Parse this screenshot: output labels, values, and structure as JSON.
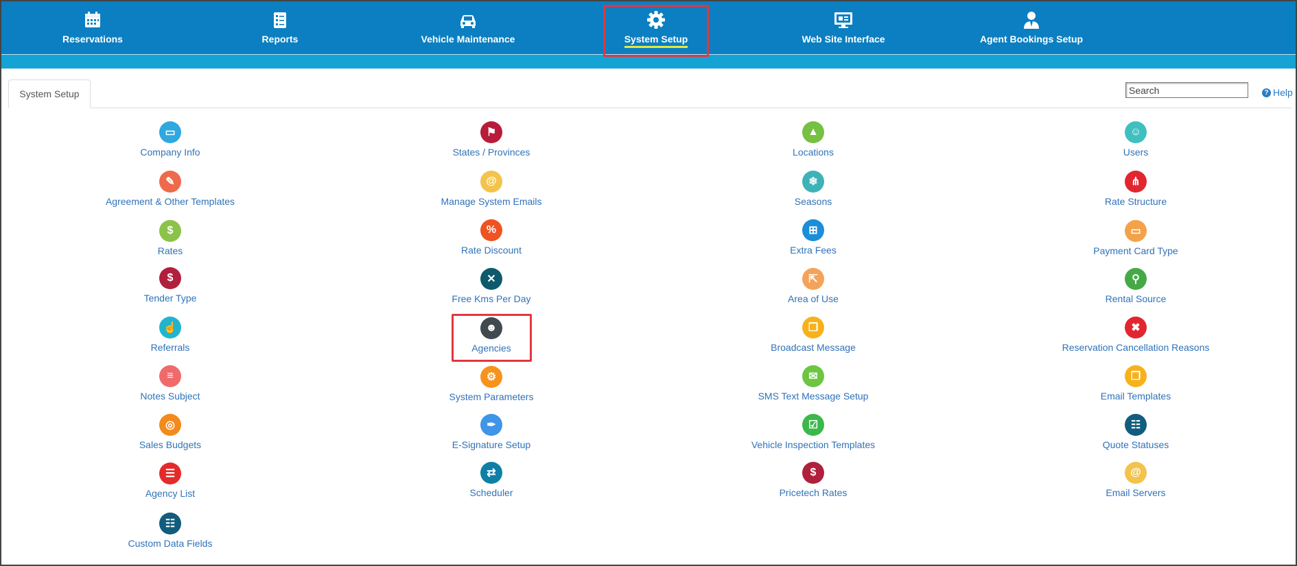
{
  "nav": {
    "items": [
      {
        "label": "Reservations",
        "icon": "calendar-icon"
      },
      {
        "label": "Reports",
        "icon": "report-checklist-icon"
      },
      {
        "label": "Vehicle Maintenance",
        "icon": "car-icon"
      },
      {
        "label": "System Setup",
        "icon": "gear-icon",
        "active": true
      },
      {
        "label": "Web Site Interface",
        "icon": "monitor-icon"
      },
      {
        "label": "Agent Bookings Setup",
        "icon": "agent-user-icon"
      }
    ]
  },
  "tab": {
    "label": "System Setup"
  },
  "search": {
    "placeholder": "Search"
  },
  "help": {
    "label": "Help"
  },
  "colors": {
    "nav_bg": "#0b7fc1",
    "subbar": "#14a3d4",
    "link": "#2f72b9",
    "highlight": "#e0373f"
  },
  "columns": [
    {
      "items": [
        {
          "label": "Company Info",
          "icon": "folder-icon",
          "color": "#2fa8e0",
          "glyph": "▭"
        },
        {
          "label": "Agreement & Other Templates",
          "icon": "edit-document-icon",
          "color": "#ee6a4b",
          "glyph": "✎"
        },
        {
          "label": "Rates",
          "icon": "rates-coins-icon",
          "color": "#8bc34a",
          "glyph": "$"
        },
        {
          "label": "Tender Type",
          "icon": "money-bag-icon",
          "color": "#b01f3c",
          "glyph": "$"
        },
        {
          "label": "Referrals",
          "icon": "hand-referral-icon",
          "color": "#20b4cf",
          "glyph": "☝"
        },
        {
          "label": "Notes Subject",
          "icon": "notes-stack-icon",
          "color": "#ef6b6b",
          "glyph": "≡"
        },
        {
          "label": "Sales Budgets",
          "icon": "target-icon",
          "color": "#f28a1c",
          "glyph": "◎"
        },
        {
          "label": "Agency List",
          "icon": "list-document-icon",
          "color": "#e42a2a",
          "glyph": "☰"
        },
        {
          "label": "Custom Data Fields",
          "icon": "list-bullets-icon",
          "color": "#125c7e",
          "glyph": "☷"
        }
      ]
    },
    {
      "items": [
        {
          "label": "States / Provinces",
          "icon": "flag-icon",
          "color": "#b71c3a",
          "glyph": "⚑"
        },
        {
          "label": "Manage System Emails",
          "icon": "at-sign-icon",
          "color": "#f3c34c",
          "glyph": "@"
        },
        {
          "label": "Rate Discount",
          "icon": "percent-icon",
          "color": "#ef5322",
          "glyph": "%"
        },
        {
          "label": "Free Kms Per Day",
          "icon": "road-crossing-icon",
          "color": "#0d5a6c",
          "glyph": "✕"
        },
        {
          "label": "Agencies",
          "icon": "people-group-icon",
          "color": "#404a4f",
          "glyph": "☻"
        },
        {
          "label": "System Parameters",
          "icon": "gears-icon",
          "color": "#f6931d",
          "glyph": "⚙"
        },
        {
          "label": "E-Signature Setup",
          "icon": "pen-signature-icon",
          "color": "#3f95e8",
          "glyph": "✒"
        },
        {
          "label": "Scheduler",
          "icon": "car-scheduler-icon",
          "color": "#0f7fa6",
          "glyph": "⇄"
        }
      ]
    },
    {
      "items": [
        {
          "label": "Locations",
          "icon": "map-location-icon",
          "color": "#76c043",
          "glyph": "▲"
        },
        {
          "label": "Seasons",
          "icon": "snowflake-icon",
          "color": "#3fb2b9",
          "glyph": "❄"
        },
        {
          "label": "Extra Fees",
          "icon": "grid-fees-icon",
          "color": "#1c8dd8",
          "glyph": "⊞"
        },
        {
          "label": "Area of Use",
          "icon": "signpost-icon",
          "color": "#f4a35a",
          "glyph": "⇱"
        },
        {
          "label": "Broadcast Message",
          "icon": "copy-windows-icon",
          "color": "#f7b21b",
          "glyph": "❐"
        },
        {
          "label": "SMS Text Message Setup",
          "icon": "sms-bubble-icon",
          "color": "#6cc640",
          "glyph": "✉"
        },
        {
          "label": "Vehicle Inspection Templates",
          "icon": "clipboard-check-icon",
          "color": "#3bb84a",
          "glyph": "☑"
        },
        {
          "label": "Pricetech Rates",
          "icon": "money-bag-icon",
          "color": "#b01f3c",
          "glyph": "$"
        }
      ]
    },
    {
      "items": [
        {
          "label": "Users",
          "icon": "users-group-icon",
          "color": "#40bfc1",
          "glyph": "☺"
        },
        {
          "label": "Rate Structure",
          "icon": "share-nodes-icon",
          "color": "#e1262f",
          "glyph": "⋔"
        },
        {
          "label": "Payment Card Type",
          "icon": "credit-card-icon",
          "color": "#f4a24a",
          "glyph": "▭"
        },
        {
          "label": "Rental Source",
          "icon": "magnifier-icon",
          "color": "#46a947",
          "glyph": "⚲"
        },
        {
          "label": "Reservation Cancellation Reasons",
          "icon": "cancel-x-icon",
          "color": "#e2262f",
          "glyph": "✖"
        },
        {
          "label": "Email Templates",
          "icon": "copy-windows-icon",
          "color": "#f7b21b",
          "glyph": "❐"
        },
        {
          "label": "Quote Statuses",
          "icon": "list-bullets-icon",
          "color": "#125c7e",
          "glyph": "☷"
        },
        {
          "label": "Email Servers",
          "icon": "at-sign-icon",
          "color": "#f3c34c",
          "glyph": "@"
        }
      ]
    }
  ]
}
